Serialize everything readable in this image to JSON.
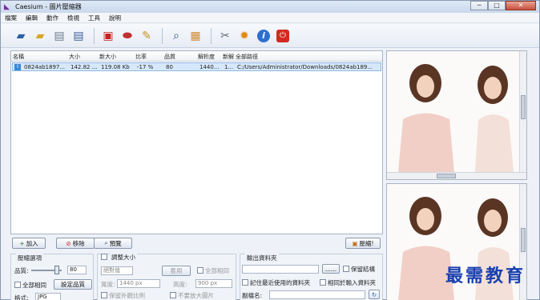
{
  "window": {
    "title": "Caesium - 圖片壓縮器",
    "app_icon": "caesium-logo-icon"
  },
  "menu": [
    "檔案",
    "編輯",
    "動作",
    "檢視",
    "工具",
    "說明"
  ],
  "toolbar": {
    "icons": [
      "open-folder-icon",
      "add-folder-icon",
      "save-icon",
      "save-as-icon",
      "remove-item-icon",
      "clear-list-icon",
      "clean-broom-icon",
      "preview-magnifier-icon",
      "image-preview-icon",
      "settings-tools-icon",
      "options-gear-icon",
      "info-icon",
      "power-exit-icon"
    ]
  },
  "file_list": {
    "columns": [
      "名稱",
      "大小",
      "新大小",
      "比率",
      "品質",
      "解析度",
      "新解",
      "全部路徑"
    ],
    "rows": [
      {
        "name": "0824ab1897...",
        "size": "142.82 ...",
        "new_size": "119.08 Kb",
        "ratio": "-17 %",
        "quality": "80",
        "resolution": "1440...",
        "new_res": "1...",
        "path": "C:/Users/Administrator/Downloads/0824ab189..."
      }
    ]
  },
  "actions": {
    "add": "加入",
    "remove": "移除",
    "preview": "預覽",
    "compress": "壓縮!"
  },
  "compression": {
    "label": "壓縮選項",
    "quality_label": "品質:",
    "quality_value": "80",
    "all_same_label": "全部相同",
    "set_quality_button": "設定品質",
    "format_label": "格式:",
    "format_value": "JPG"
  },
  "resize": {
    "label": "調整大小",
    "mode_value": "絕對值",
    "apply_button": "套用",
    "all_same_label": "全部相同",
    "width_label": "寬度:",
    "width_value": "1440 px",
    "height_label": "高度:",
    "height_value": "900 px",
    "keep_ratio_label": "保留外觀比例",
    "no_enlarge_label": "不要放大圖片"
  },
  "output": {
    "label": "輸出資料夾",
    "browse_button": "......",
    "keep_structure_label": "保留結構",
    "use_last_label": "記住最近使用的資料夾",
    "same_as_input_label": "相同於輸入資料夾",
    "suffix_label": "副檔名:"
  },
  "watermark": "最需教育"
}
